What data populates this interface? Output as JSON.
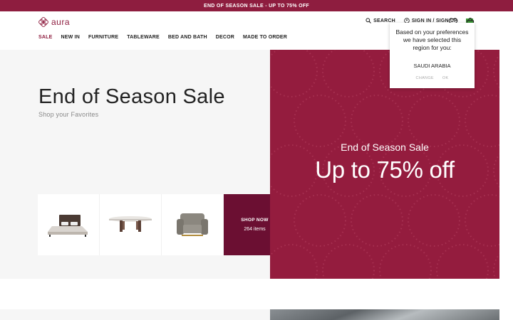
{
  "announcement": "END OF SEASON SALE - UP TO 75% OFF",
  "logo": {
    "text": "aura",
    "icon": "aura-logo-icon"
  },
  "utilities": {
    "search": "SEARCH",
    "sign_in": "SIGN IN / SIGN UP",
    "wishlist_icon": "heart-icon",
    "cart_icon": "bag-icon"
  },
  "nav": [
    "SALE",
    "NEW IN",
    "FURNITURE",
    "TABLEWARE",
    "BED AND BATH",
    "DECOR",
    "MADE TO ORDER"
  ],
  "hero": {
    "title": "End of Season Sale",
    "subtitle": "Shop your Favorites"
  },
  "products": [
    {
      "icon": "bed-image"
    },
    {
      "icon": "dining-table-image"
    },
    {
      "icon": "armchair-image"
    }
  ],
  "shop_tile": {
    "label": "SHOP NOW",
    "count": "264 items"
  },
  "promo": {
    "small": "End of Season Sale",
    "big": "Up to 75% off"
  },
  "region_popup": {
    "message": "Based on your preferences we have selected this region for you:",
    "country": "SAUDI ARABIA",
    "change": "CHANGE",
    "ok": "OK"
  },
  "colors": {
    "brand": "#8e1d3f",
    "promo_bg": "#941c3e",
    "shop_bg": "#6b0f32"
  }
}
